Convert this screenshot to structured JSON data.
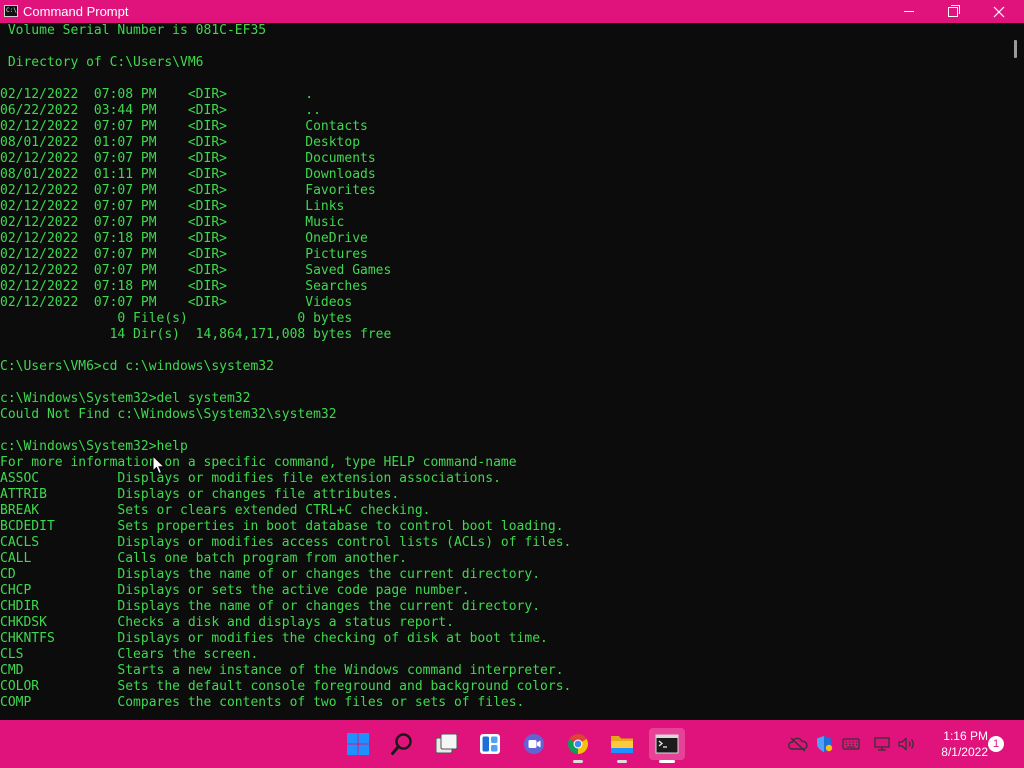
{
  "window": {
    "title": "Command Prompt",
    "icon_text": "C:\\"
  },
  "console": {
    "lines": [
      " Volume Serial Number is 081C-EF35",
      "",
      " Directory of C:\\Users\\VM6",
      "",
      "02/12/2022  07:08 PM    <DIR>          .",
      "06/22/2022  03:44 PM    <DIR>          ..",
      "02/12/2022  07:07 PM    <DIR>          Contacts",
      "08/01/2022  01:07 PM    <DIR>          Desktop",
      "02/12/2022  07:07 PM    <DIR>          Documents",
      "08/01/2022  01:11 PM    <DIR>          Downloads",
      "02/12/2022  07:07 PM    <DIR>          Favorites",
      "02/12/2022  07:07 PM    <DIR>          Links",
      "02/12/2022  07:07 PM    <DIR>          Music",
      "02/12/2022  07:18 PM    <DIR>          OneDrive",
      "02/12/2022  07:07 PM    <DIR>          Pictures",
      "02/12/2022  07:07 PM    <DIR>          Saved Games",
      "02/12/2022  07:18 PM    <DIR>          Searches",
      "02/12/2022  07:07 PM    <DIR>          Videos",
      "               0 File(s)              0 bytes",
      "              14 Dir(s)  14,864,171,008 bytes free",
      "",
      "C:\\Users\\VM6>cd c:\\windows\\system32",
      "",
      "c:\\Windows\\System32>del system32",
      "Could Not Find c:\\Windows\\System32\\system32",
      "",
      "c:\\Windows\\System32>help",
      "For more information on a specific command, type HELP command-name",
      "ASSOC          Displays or modifies file extension associations.",
      "ATTRIB         Displays or changes file attributes.",
      "BREAK          Sets or clears extended CTRL+C checking.",
      "BCDEDIT        Sets properties in boot database to control boot loading.",
      "CACLS          Displays or modifies access control lists (ACLs) of files.",
      "CALL           Calls one batch program from another.",
      "CD             Displays the name of or changes the current directory.",
      "CHCP           Displays or sets the active code page number.",
      "CHDIR          Displays the name of or changes the current directory.",
      "CHKDSK         Checks a disk and displays a status report.",
      "CHKNTFS        Displays or modifies the checking of disk at boot time.",
      "CLS            Clears the screen.",
      "CMD            Starts a new instance of the Windows command interpreter.",
      "COLOR          Sets the default console foreground and background colors.",
      "COMP           Compares the contents of two files or sets of files."
    ],
    "colors": {
      "text": "#3fd84f",
      "background": "#0c0c0c"
    }
  },
  "taskbar": {
    "accent": "#e0137d",
    "apps": [
      {
        "name": "start-button",
        "icon": "windows-logo-icon"
      },
      {
        "name": "search-button",
        "icon": "search-icon"
      },
      {
        "name": "task-view-button",
        "icon": "task-view-icon"
      },
      {
        "name": "widgets-button",
        "icon": "widgets-icon"
      },
      {
        "name": "teams-chat-button",
        "icon": "teams-chat-icon"
      },
      {
        "name": "chrome-button",
        "icon": "chrome-icon"
      },
      {
        "name": "file-explorer-button",
        "icon": "folder-icon"
      },
      {
        "name": "command-prompt-button",
        "icon": "terminal-icon"
      }
    ],
    "tray": {
      "time": "1:16 PM",
      "date": "8/1/2022",
      "notification_count": "1"
    }
  }
}
